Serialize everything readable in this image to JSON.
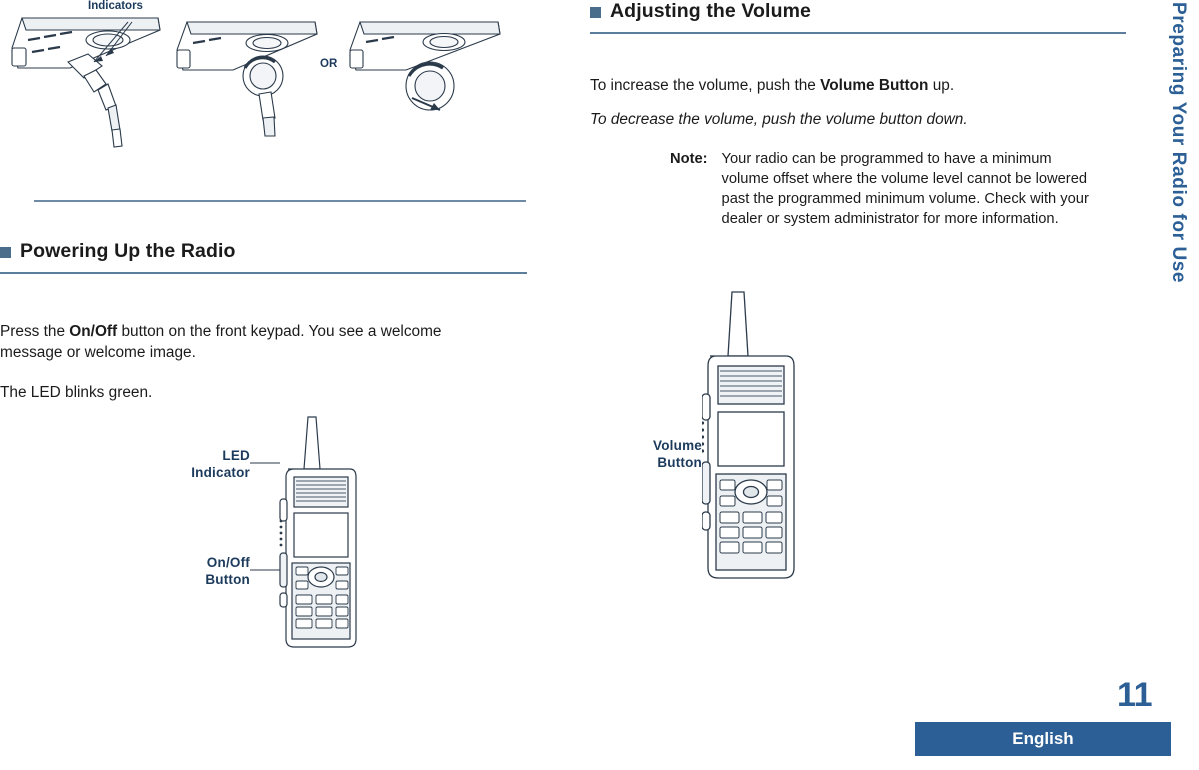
{
  "document": {
    "page_number": "11",
    "language": "English",
    "side_tab": "Preparing Your Radio for Use"
  },
  "left_column": {
    "top_figure": {
      "indicators_label": "Indicators",
      "or_label": "OR"
    },
    "section": {
      "title": "Powering Up the Radio",
      "paragraphs": [
        {
          "parts": [
            {
              "text": "Press the ",
              "style": "normal"
            },
            {
              "text": "On/Off",
              "style": "bold"
            },
            {
              "text": " button on the front keypad.  You see a welcome message or welcome image.",
              "style": "normal"
            }
          ]
        },
        {
          "parts": [
            {
              "text": "The LED blinks green.",
              "style": "normal"
            }
          ]
        }
      ]
    },
    "radio_figure": {
      "label_led_line1": "LED",
      "label_led_line2": "Indicator",
      "label_onoff_line1": "On/Off",
      "label_onoff_line2": "Button"
    }
  },
  "right_column": {
    "section": {
      "title": "Adjusting the Volume",
      "paragraph_1_parts": [
        {
          "text": "To increase the volume, push the ",
          "style": "normal"
        },
        {
          "text": "Volume Button",
          "style": "bold"
        },
        {
          "text": " up.",
          "style": "normal"
        }
      ],
      "paragraph_2": "To decrease the volume, push the volume button down.",
      "note": {
        "label": "Note:",
        "body": "Your radio can be programmed to have a minimum volume offset where the volume level cannot be lowered past the programmed minimum volume.  Check with your dealer or system administrator for more information."
      }
    },
    "radio_figure": {
      "label_volume_line1": "Volume",
      "label_volume_line2": "Button"
    }
  },
  "colors": {
    "accent_blue": "#2b5f96",
    "rule_blue": "#5a7e9c",
    "square_blue": "#4a6d8c",
    "text": "#1b1b1b"
  }
}
